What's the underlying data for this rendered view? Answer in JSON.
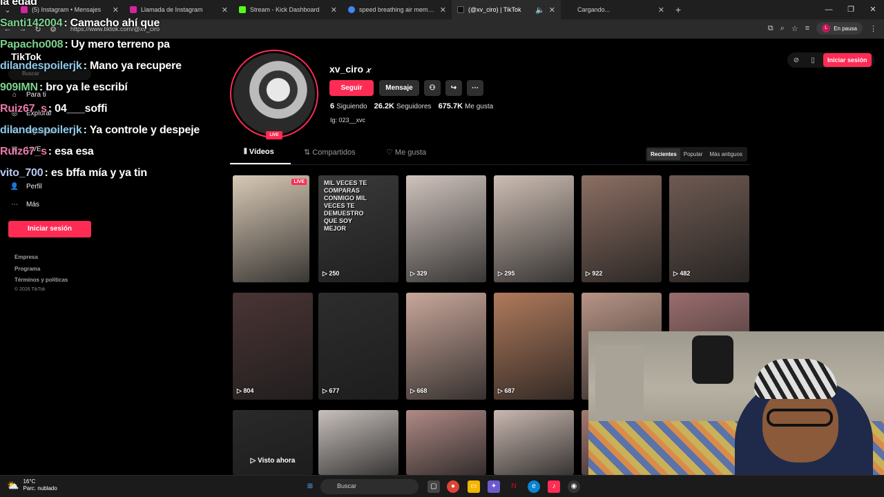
{
  "browser": {
    "tabs": [
      {
        "title": "(5) Instagram • Mensajes",
        "color": "#d6249f"
      },
      {
        "title": "Llamada de Instagram",
        "color": "#d6249f"
      },
      {
        "title": "Stream - Kick Dashboard",
        "color": "#53fc18"
      },
      {
        "title": "speed breathing air meme - Bu",
        "color": "#4285f4"
      },
      {
        "title": "(@xv_ciro) | TikTok",
        "color": "#222222"
      },
      {
        "title": "Cargando...",
        "color": "#555555"
      }
    ],
    "url": "https://www.tiktok.com/@xv_ciro",
    "pause_label": "En pausa",
    "profile_initial": "L"
  },
  "sidebar": {
    "logo": "TikTok",
    "search_placeholder": "Buscar",
    "items": [
      {
        "label": "Para ti",
        "icon": "home-icon"
      },
      {
        "label": "Explorar",
        "icon": "compass-icon"
      },
      {
        "label": "Siguiendo",
        "icon": "following-icon"
      },
      {
        "label": "LIVE",
        "icon": "live-icon"
      },
      {
        "label": "Perfil",
        "icon": "user-icon"
      },
      {
        "label": "Más",
        "icon": "more-icon"
      }
    ],
    "login": "Iniciar sesión",
    "footer": [
      "Empresa",
      "Programa",
      "Términos y políticas"
    ],
    "copyright": "© 2026 TikTok"
  },
  "chat": [
    {
      "user": "la edad",
      "msg": "",
      "color": "#ffffff"
    },
    {
      "user": "Santi142004",
      "msg": ": Camacho ahí que",
      "color": "#7cd38f"
    },
    {
      "user": "Papacho008",
      "msg": ": Uy mero terreno pa",
      "color": "#7cd38f"
    },
    {
      "user": "dilandespoilerjk",
      "msg": ": Mano ya recupere",
      "color": "#8fc8e8"
    },
    {
      "user": "909IMN",
      "msg": ": bro ya le escribí",
      "color": "#7cd38f"
    },
    {
      "user": "Ruiz67_s",
      "msg": ": 04___soffi",
      "color": "#e97aa8"
    },
    {
      "user": "dilandespoilerjk",
      "msg": ": Ya controle y despeje",
      "color": "#8fc8e8"
    },
    {
      "user": "Ruiz67_s",
      "msg": ": esa esa",
      "color": "#e97aa8"
    },
    {
      "user": "vito_700",
      "msg": ": es bffa mía y ya tin",
      "color": "#b8c8f0"
    }
  ],
  "profile": {
    "username": "xv_ciro",
    "live_badge": "LIVE",
    "follow": "Seguir",
    "message": "Mensaje",
    "stats": [
      {
        "value": "6",
        "label": "Siguiendo"
      },
      {
        "value": "26.2K",
        "label": "Seguidores"
      },
      {
        "value": "675.7K",
        "label": "Me gusta"
      }
    ],
    "bio": "Ig: 023__xvc",
    "login": "Iniciar sesión"
  },
  "tabs": {
    "videos": "Vídeos",
    "shared": "Compartidos",
    "liked": "Me gusta"
  },
  "sort": [
    "Recientes",
    "Popular",
    "Más antiguos"
  ],
  "videos": [
    {
      "views": "",
      "label": "LIVE",
      "bg": "#d8c9b5"
    },
    {
      "views": "250",
      "overlay": "MIL VECES TE COMPARAS CONMIGO MIL VECES TE DEMUESTRO QUE SOY MEJOR",
      "bg": "#3a3a3a"
    },
    {
      "views": "329",
      "bg": "#cfc3bd"
    },
    {
      "views": "295",
      "bg": "#cdbdb3"
    },
    {
      "views": "922",
      "bg": "#8c6f63"
    },
    {
      "views": "482",
      "bg": "#6e5a52"
    },
    {
      "views": "804",
      "bg": "#4a3434"
    },
    {
      "views": "677",
      "bg": "#2d2d2d"
    },
    {
      "views": "668",
      "bg": "#c9a79b"
    },
    {
      "views": "687",
      "bg": "#b07a5c"
    },
    {
      "views": "",
      "bg": "#b89486"
    },
    {
      "views": "",
      "bg": "#9a6d6e"
    },
    {
      "views": "",
      "watched": "Visto ahora",
      "bg": "#2a2a2a"
    },
    {
      "views": "",
      "bg": "#c8c0bc"
    },
    {
      "views": "",
      "bg": "#b08a86"
    },
    {
      "views": "",
      "bg": "#c9b8b0"
    },
    {
      "views": "",
      "bg": "#a67a74"
    }
  ],
  "taskbar": {
    "temp": "16°C",
    "weather": "Parc. nublado",
    "search": "Buscar"
  }
}
